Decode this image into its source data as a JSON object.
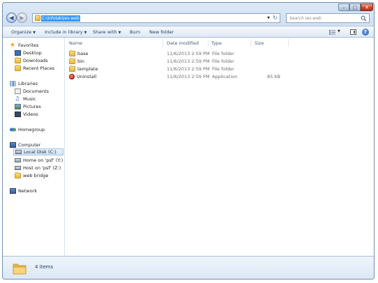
{
  "window": {
    "address": "C:\\Infolab\\ies-web",
    "search_placeholder": "Search ies-web"
  },
  "toolbar": {
    "organize": "Organize",
    "include_in_library": "Include in library",
    "share_with": "Share with",
    "burn": "Burn",
    "new_folder": "New folder"
  },
  "nav": {
    "favorites": "Favorites",
    "desktop": "Desktop",
    "downloads": "Downloads",
    "recent_places": "Recent Places",
    "libraries": "Libraries",
    "documents": "Documents",
    "music": "Music",
    "pictures": "Pictures",
    "videos": "Videos",
    "homegroup": "Homegroup",
    "computer": "Computer",
    "local_disk": "Local Disk (C:)",
    "home_psf": "Home on 'psf' (Y:)",
    "host_psf": "Host on 'psf' (Z:)",
    "web_bridge": "web bridge",
    "network": "Network"
  },
  "columns": {
    "name": "Name",
    "date_modified": "Date modified",
    "type": "Type",
    "size": "Size"
  },
  "files": [
    {
      "name": "base",
      "date": "11/6/2013 2:59 PM",
      "type": "File folder",
      "size": "",
      "icon": "folder"
    },
    {
      "name": "bin",
      "date": "11/6/2013 2:59 PM",
      "type": "File folder",
      "size": "",
      "icon": "folder"
    },
    {
      "name": "template",
      "date": "11/6/2013 2:59 PM",
      "type": "File folder",
      "size": "",
      "icon": "folder"
    },
    {
      "name": "Uninstall",
      "date": "11/6/2013 2:59 PM",
      "type": "Application",
      "size": "85 KB",
      "icon": "uninstall"
    }
  ],
  "details": {
    "item_count": "4 items"
  }
}
